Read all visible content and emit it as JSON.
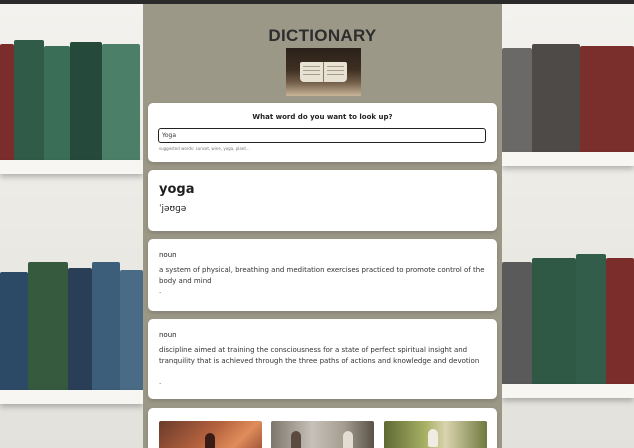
{
  "app": {
    "title": "DICTIONARY"
  },
  "search": {
    "prompt": "What word do you want to look up?",
    "value": "Yoga",
    "hint": "suggested words: sunset, wine, yoga, plant..."
  },
  "result": {
    "word": "yoga",
    "phonetic": "ˈjəʊɡə"
  },
  "meanings": [
    {
      "part_of_speech": "noun",
      "definition": "a system of physical, breathing and meditation exercises practiced to promote control of the body and mind",
      "bullet": "."
    },
    {
      "part_of_speech": "noun",
      "definition": "discipline aimed at training the consciousness for a state of perfect spiritual insight and tranquility that is achieved through the three paths of actions and knowledge and devotion",
      "bullet": "."
    }
  ],
  "colors": {
    "page_background": "#9c9887",
    "card_background": "#ffffff",
    "text": "#222222"
  }
}
